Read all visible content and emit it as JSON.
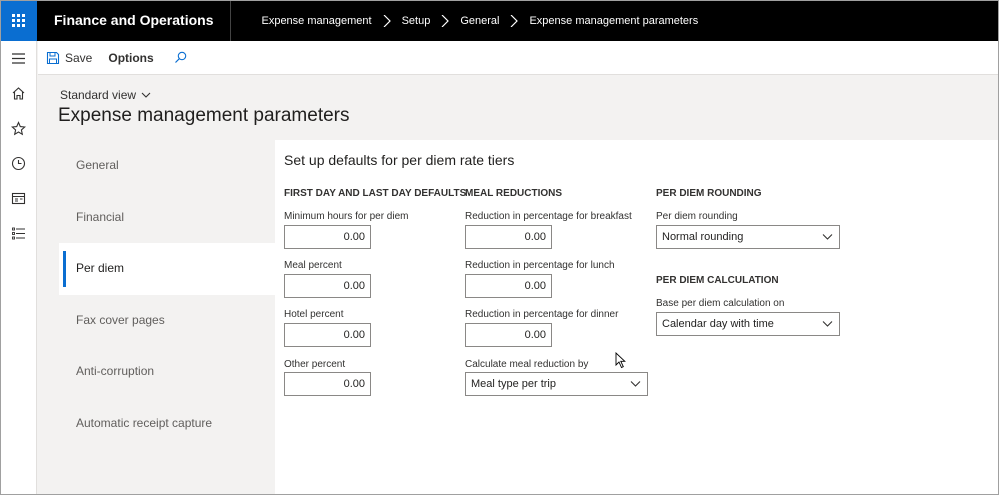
{
  "app": {
    "title": "Finance and Operations",
    "breadcrumb": [
      "Expense management",
      "Setup",
      "General",
      "Expense management parameters"
    ]
  },
  "sidenav": {
    "items": [
      "menu-icon",
      "home-icon",
      "star-icon",
      "clock-icon",
      "workspace-icon",
      "list-icon"
    ]
  },
  "actionbar": {
    "save_label": "Save",
    "options_label": "Options"
  },
  "page": {
    "view_label": "Standard view",
    "title": "Expense management parameters"
  },
  "tabs": [
    {
      "label": "General",
      "active": false
    },
    {
      "label": "Financial",
      "active": false
    },
    {
      "label": "Per diem",
      "active": true
    },
    {
      "label": "Fax cover pages",
      "active": false
    },
    {
      "label": "Anti-corruption",
      "active": false
    },
    {
      "label": "Automatic receipt capture",
      "active": false
    }
  ],
  "content": {
    "section_title": "Set up defaults for per diem rate tiers",
    "first_last_day": {
      "heading": "FIRST DAY AND LAST DAY DEFAULTS",
      "fields": [
        {
          "label": "Minimum hours for per diem",
          "value": "0.00"
        },
        {
          "label": "Meal percent",
          "value": "0.00"
        },
        {
          "label": "Hotel percent",
          "value": "0.00"
        },
        {
          "label": "Other percent",
          "value": "0.00"
        }
      ]
    },
    "meal_reductions": {
      "heading": "MEAL REDUCTIONS",
      "fields": [
        {
          "label": "Reduction in percentage for breakfast",
          "value": "0.00"
        },
        {
          "label": "Reduction in percentage for lunch",
          "value": "0.00"
        },
        {
          "label": "Reduction in percentage for dinner",
          "value": "0.00"
        }
      ],
      "calc_label": "Calculate meal reduction by",
      "calc_value": "Meal type per trip"
    },
    "rounding": {
      "heading": "PER DIEM ROUNDING",
      "label": "Per diem rounding",
      "value": "Normal rounding"
    },
    "calculation": {
      "heading": "PER DIEM CALCULATION",
      "label": "Base per diem calculation on",
      "value": "Calendar day with time"
    }
  },
  "colors": {
    "accent": "#0a6ed1",
    "topbar": "#000000",
    "background": "#f3f2f1"
  }
}
